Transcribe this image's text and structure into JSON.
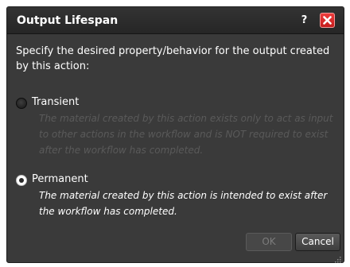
{
  "dialog": {
    "title": "Output Lifespan",
    "help_glyph": "?",
    "description": "Specify the desired property/behavior for the output created by this action:",
    "options": [
      {
        "label": "Transient",
        "selected": false,
        "enabled": false,
        "description": "The material created by this action exists only to act as input to other actions in the workflow and is NOT required to exist after the workflow has completed."
      },
      {
        "label": "Permanent",
        "selected": true,
        "enabled": true,
        "description": "The material created by this action is intended to exist after the workflow has completed."
      }
    ],
    "buttons": {
      "ok_label": "OK",
      "ok_enabled": false,
      "cancel_label": "Cancel"
    }
  },
  "icons": {
    "help": "help-icon",
    "close": "close-icon",
    "resize": "resize-grip-icon"
  },
  "colors": {
    "dialog_background": "#3a3a3a",
    "title_bar": "#2a2a2a",
    "close_button": "#d62a2a",
    "disabled_text": "#5a5a5a",
    "text": "#ffffff"
  }
}
